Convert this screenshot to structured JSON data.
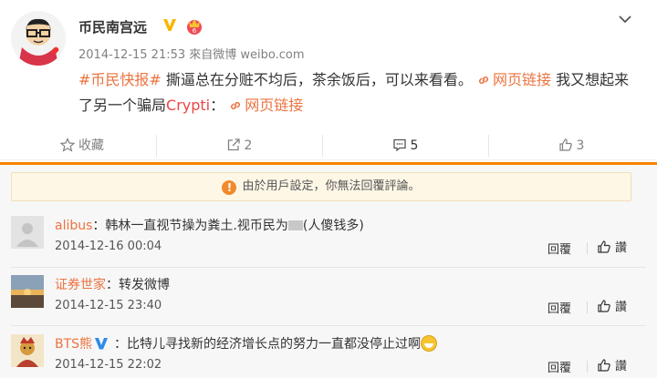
{
  "post": {
    "author": "币民南宫远",
    "timestamp": "2014-12-15 21:53",
    "source": "來自微博 weibo.com",
    "topic": "#币民快报#",
    "text_1": " 撕逼总在分赃不均后，茶余饭后，可以来看看。",
    "link_1": "网页链接",
    "text_2": " 我又想起来了另一个骗局",
    "keyword": "Crypti",
    "text_3": "：",
    "link_2": "网页链接"
  },
  "actions": {
    "favorite": "收藏",
    "repost": "2",
    "comment": "5",
    "like": "3"
  },
  "notice": "由於用戶設定，你無法回覆評論。",
  "comment_actions": {
    "reply": "回覆",
    "like": "讚"
  },
  "comments": [
    {
      "user": "alibus",
      "sep": "：",
      "text_a": "韩林一直视节操为粪土.视币民为",
      "text_b": "(人傻钱多)",
      "time": "2014-12-16 00:04"
    },
    {
      "user": "证券世家",
      "sep": "：",
      "text_a": "转发微博",
      "time": "2014-12-15 23:40"
    },
    {
      "user": "BTS熊",
      "sep": "：",
      "text_a": "比特儿寻找新的经济增长点的努力一直都没停止过啊",
      "time": "2014-12-15 22:02"
    }
  ],
  "colors": {
    "accent": "#eb7340",
    "tab_underline": "#ff8200",
    "verified": "#f7b500"
  },
  "icons": [
    "chevron-down-icon",
    "verified-icon",
    "vip-crown-icon",
    "link-icon",
    "star-icon",
    "repost-icon",
    "comment-icon",
    "thumbs-up-icon",
    "warning-icon"
  ]
}
